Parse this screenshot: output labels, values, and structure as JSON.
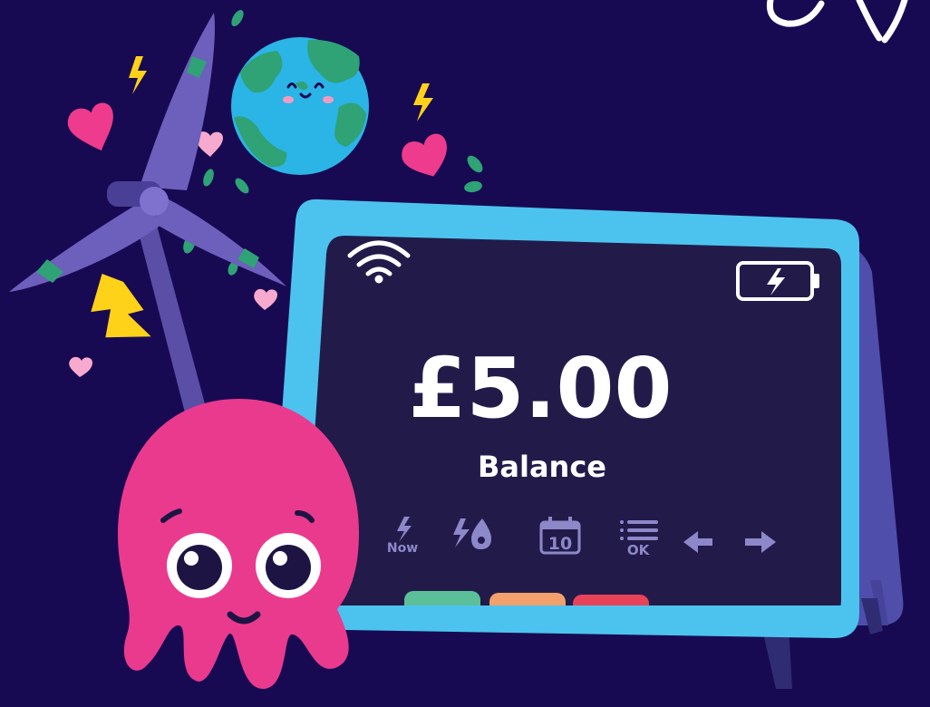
{
  "display": {
    "balance": "£5.00",
    "balance_label": "Balance",
    "icons": {
      "now_label": "Now",
      "calendar_day": "10",
      "ok_label": "OK"
    }
  },
  "colors": {
    "background": "#180a52",
    "device_frame": "#4cc3ef",
    "screen": "#221b4a",
    "device_side": "#4f4eaa",
    "octopus": "#ea3a8e",
    "button_green": "#5bbf99",
    "button_orange": "#f2a06c",
    "button_red": "#e8425a",
    "turbine": "#5a4ea6",
    "bolt": "#ffd21a",
    "heart": "#ee3b8d",
    "earth_water": "#2bb4e6",
    "earth_land": "#2fa276"
  },
  "icon_names": [
    "wifi-icon",
    "battery-charging-icon",
    "lightning-now-icon",
    "dual-fuel-icon",
    "calendar-icon",
    "menu-ok-icon",
    "arrow-left-icon",
    "arrow-right-icon"
  ]
}
